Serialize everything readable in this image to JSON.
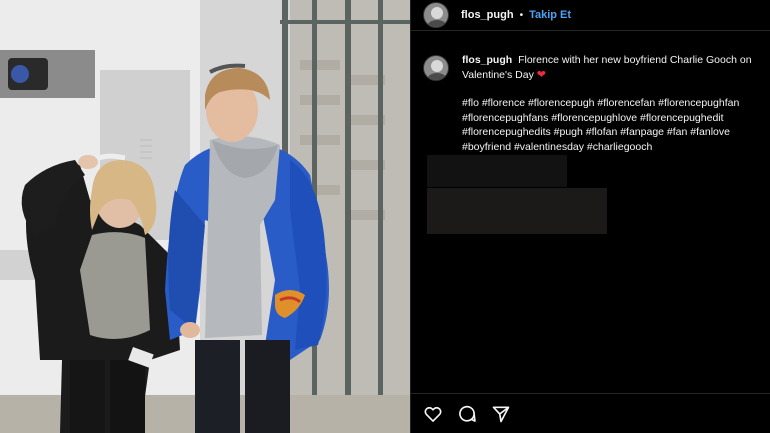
{
  "post": {
    "username": "flos_pugh",
    "separator": "•",
    "follow_label": "Takip Et",
    "caption_text": "Florence with her new boyfriend Charlie Gooch on Valentine's Day",
    "heart_emoji": "❤",
    "hashtags": "#flo #florence #florencepugh #florencefan #florencepughfan #florencepughfans #florencepughlove #florencepughedit #florencepughedits #pugh #flofan #fanpage #fan #fanlove #boyfriend #valentinesday #charliegooch"
  },
  "actions": {
    "like_icon": "heart-outline-icon",
    "comment_icon": "speech-bubble-icon",
    "share_icon": "paper-plane-icon"
  },
  "colors": {
    "background": "#000000",
    "follow_blue": "#4aa3f5",
    "heart_red": "#ed2b3f",
    "text": "#f5f5f5"
  }
}
